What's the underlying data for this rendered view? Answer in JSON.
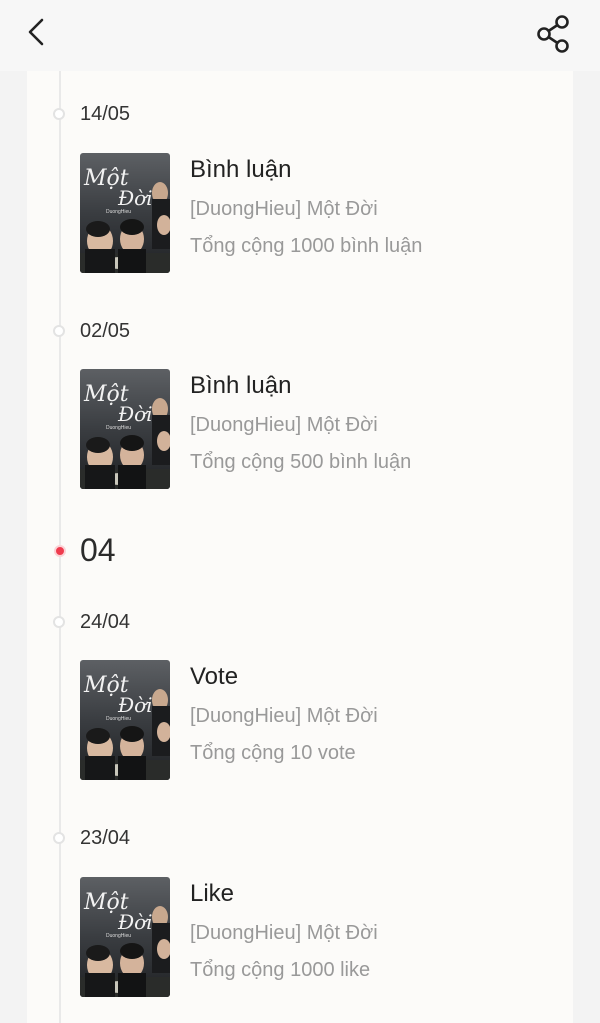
{
  "header": {
    "back_icon": "chevron-left-icon",
    "share_icon": "share-icon"
  },
  "timeline": {
    "entries": [
      {
        "date": "14/05",
        "type": "Bình luận",
        "story": "[DuongHieu] Một Đời",
        "total": "Tổng cộng 1000 bình luận"
      },
      {
        "date": "02/05",
        "type": "Bình luận",
        "story": "[DuongHieu] Một Đời",
        "total": "Tổng cộng 500 bình luận"
      },
      {
        "date": "24/04",
        "type": "Vote",
        "story": "[DuongHieu] Một Đời",
        "total": "Tổng cộng 10 vote"
      },
      {
        "date": "23/04",
        "type": "Like",
        "story": "[DuongHieu] Một Đời",
        "total": "Tổng cộng 1000 like"
      }
    ],
    "month_marker": "04"
  },
  "cover": {
    "title_line1": "Một",
    "title_line2": "Đời",
    "author": "DuongHieu"
  },
  "colors": {
    "accent_dot": "#ef3b4e",
    "timeline_line": "#e9e9e9",
    "card_bg": "#fcfbf9",
    "page_bg": "#f3f3f3"
  }
}
